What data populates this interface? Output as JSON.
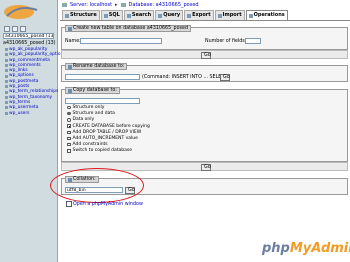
{
  "left": {
    "logo_text": "phpMyAdmin",
    "database_select": "a4310665_posed (13)",
    "database_heading": "a4310665_posed (13)",
    "tables": [
      "wp_ak_popularity",
      "wp_ak_popularity_options",
      "wp_commentmeta",
      "wp_comments",
      "wp_links",
      "wp_options",
      "wp_postmeta",
      "wp_posts",
      "wp_term_relationships",
      "wp_term_taxonomy",
      "wp_terms",
      "wp_usermeta",
      "wp_users"
    ]
  },
  "breadcrumb": {
    "server_label": "Server: localhost",
    "separator": "▸",
    "database_label": "Database: a4310665_posed"
  },
  "tabs": [
    {
      "label": "Structure",
      "active": false
    },
    {
      "label": "SQL",
      "active": false
    },
    {
      "label": "Search",
      "active": false
    },
    {
      "label": "Query",
      "active": false
    },
    {
      "label": "Export",
      "active": false
    },
    {
      "label": "Import",
      "active": false
    },
    {
      "label": "Operations",
      "active": true
    }
  ],
  "create_table": {
    "legend": "Create new table on database a4310665_posed",
    "name_label": "Name:",
    "fields_label": "Number of fields:",
    "go": "Go"
  },
  "rename_db": {
    "legend": "Rename database to:",
    "comment": "(Command: INSERT INTO ... SELECT)",
    "go": "Go"
  },
  "copy_db": {
    "legend": "Copy database to:",
    "options": [
      {
        "type": "radio",
        "label": "Structure only",
        "checked": false
      },
      {
        "type": "radio",
        "label": "Structure and data",
        "checked": true
      },
      {
        "type": "radio",
        "label": "Data only",
        "checked": false
      },
      {
        "type": "check",
        "label": "CREATE DATABASE before copying",
        "checked": true
      },
      {
        "type": "check",
        "label": "Add DROP TABLE / DROP VIEW",
        "checked": false
      },
      {
        "type": "check",
        "label": "Add AUTO_INCREMENT value",
        "checked": false
      },
      {
        "type": "check",
        "label": "Add constraints",
        "checked": false
      },
      {
        "type": "check",
        "label": "Switch to copied database",
        "checked": false
      }
    ],
    "go": "Go"
  },
  "collation": {
    "legend": "Collation:",
    "selected": "utf8_bin",
    "go": "Go"
  },
  "pma_window": "Open a phpMyAdmin window",
  "brand": {
    "part1": "php",
    "part2": "MyAdmin"
  },
  "colors": {
    "highlight": "#e01818",
    "link": "#0000cc",
    "sidebar": "#d0dce0"
  }
}
